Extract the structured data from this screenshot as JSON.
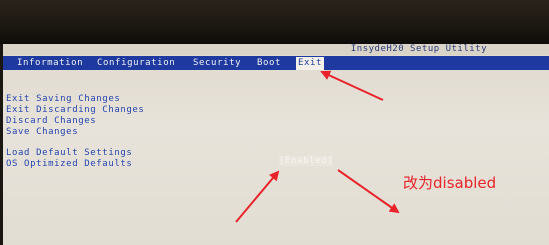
{
  "title": "InsydeH20 Setup Utility",
  "menu": {
    "information": "Information",
    "configuration": "Configuration",
    "security": "Security",
    "boot": "Boot",
    "exit": "Exit"
  },
  "options": [
    "Exit Saving Changes",
    "Exit Discarding Changes",
    "Discard Changes",
    "Save Changes",
    "Load Default Settings",
    "OS Optimized Defaults"
  ],
  "os_optimized_value": "[Enabled]",
  "annotation": "改为disabled",
  "colors": {
    "menu_bar": "#1e3aa0",
    "option_text": "#2545b0",
    "annotation": "#e8232a"
  }
}
